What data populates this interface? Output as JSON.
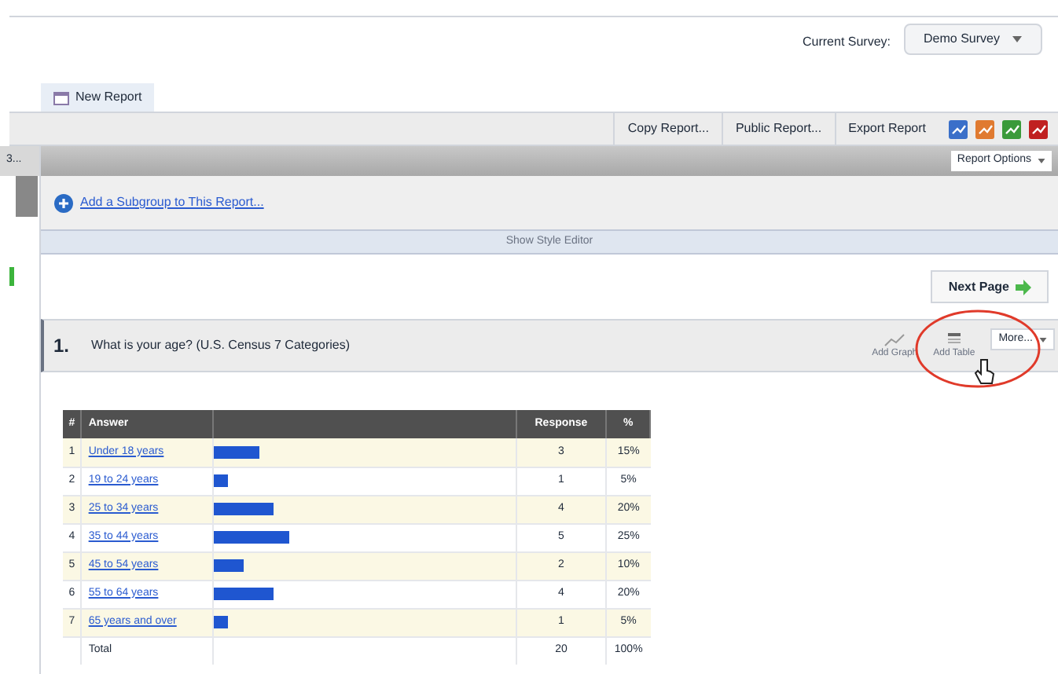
{
  "header": {
    "survey_label": "Current Survey:",
    "survey_value": "Demo Survey"
  },
  "tabs": [
    {
      "label": "New Report",
      "selected": true
    }
  ],
  "toolbar": {
    "buttons": [
      "Copy Report...",
      "Public Report...",
      "Export Report"
    ]
  },
  "sidebar": {
    "label": "3..."
  },
  "report_options": "Report Options",
  "subgroup_link": "Add a Subgroup to This Report...",
  "style_editor": "Show Style Editor",
  "next_page": "Next Page",
  "question": {
    "number": "1.",
    "text": "What is your age? (U.S. Census 7 Categories)",
    "actions": [
      "Add Graph",
      "Add Table"
    ],
    "more": "More..."
  },
  "table": {
    "columns": [
      "#",
      "Answer",
      "Response",
      "%"
    ],
    "rows": [
      {
        "index": "1",
        "answer": "Under 18 years",
        "level": 0.15,
        "response": "3",
        "percent": "15%"
      },
      {
        "index": "2",
        "answer": "19 to 24 years",
        "level": 0.05,
        "response": "1",
        "percent": "5%"
      },
      {
        "index": "3",
        "answer": "25 to 34 years",
        "level": 0.2,
        "response": "4",
        "percent": "20%"
      },
      {
        "index": "4",
        "answer": "35 to 44 years",
        "level": 0.25,
        "response": "5",
        "percent": "25%"
      },
      {
        "index": "5",
        "answer": "45 to 54 years",
        "level": 0.1,
        "response": "2",
        "percent": "10%"
      },
      {
        "index": "6",
        "answer": "55 to 64 years",
        "level": 0.2,
        "response": "4",
        "percent": "20%"
      },
      {
        "index": "7",
        "answer": "65 years and over",
        "level": 0.05,
        "response": "1",
        "percent": "5%"
      }
    ],
    "total": {
      "label": "Total",
      "response": "20",
      "percent": "100%"
    }
  }
}
